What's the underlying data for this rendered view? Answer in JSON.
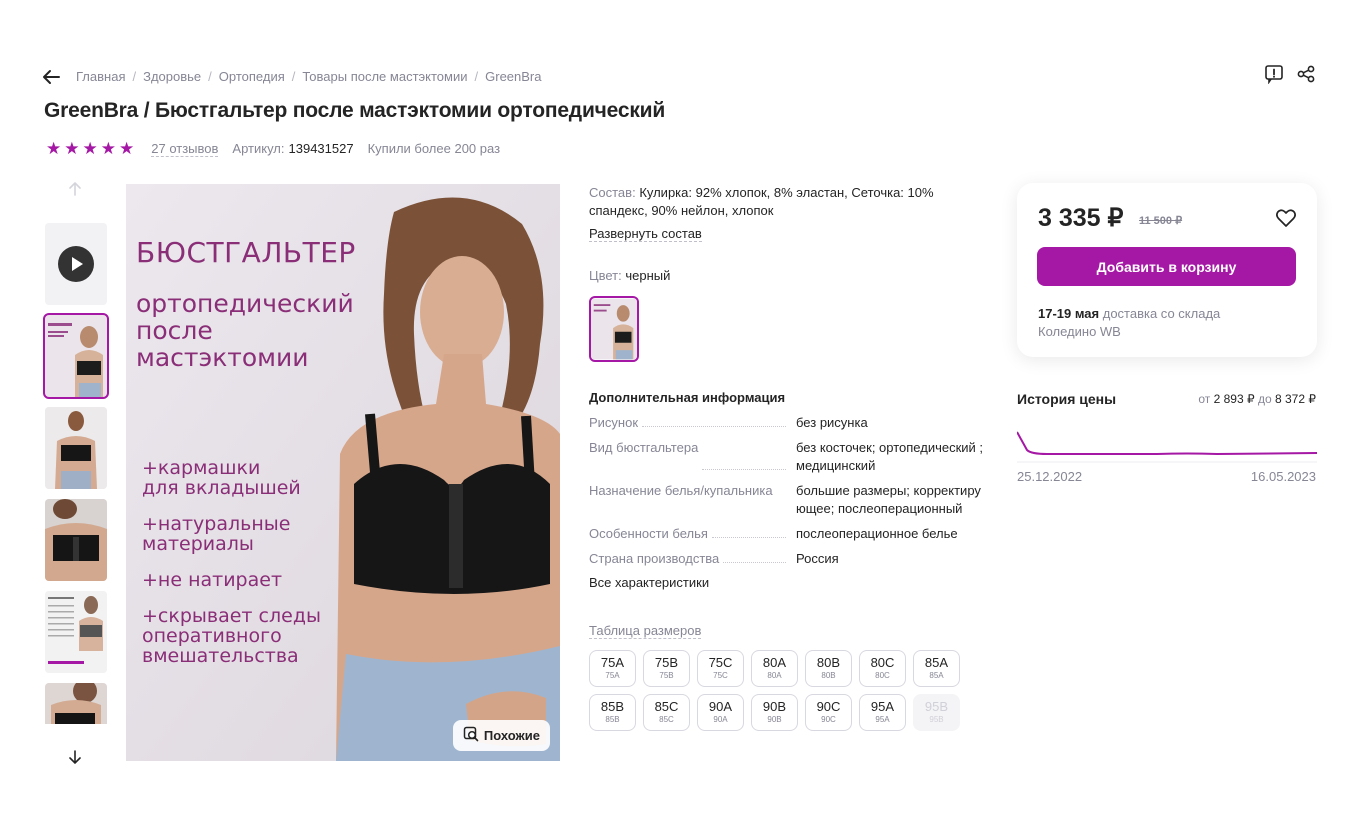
{
  "breadcrumb": [
    "Главная",
    "Здоровье",
    "Ортопедия",
    "Товары после мастэктомии",
    "GreenBra"
  ],
  "breadcrumb_sep": "/",
  "title": "GreenBra / Бюстгальтер после мастэктомии ортопедический",
  "rating": {
    "stars": 5,
    "reviews": "27 отзывов"
  },
  "article": {
    "label": "Артикул:",
    "value": "139431527"
  },
  "bought": "Купили более 200 раз",
  "icons": {
    "back": "arrow-left-icon",
    "report": "report-icon",
    "share": "share-icon",
    "play": "play-icon",
    "heart": "heart-icon",
    "similar": "search-similar-icon"
  },
  "promo": {
    "heading": "БЮСТГАЛЬТЕР",
    "sub": "ортопедический\nпосле\nмастэктомии",
    "bullets": [
      "+кармашки\nдля вкладышей",
      "+натуральные\nматериалы",
      "+не натирает",
      "+скрывает следы\nоперативного\nвмешательства"
    ]
  },
  "similar_label": "Похожие",
  "composition": {
    "label": "Состав:",
    "value": "Кулирка: 92% хлопок, 8% эластан, Сеточка: 10% спандекс, 90% нейлон, хлопок",
    "expand": "Развернуть состав"
  },
  "color": {
    "label": "Цвет:",
    "value": "черный"
  },
  "additional": {
    "title": "Дополнительная информация",
    "props": [
      {
        "k": "Рисунок",
        "v": "без рисунка"
      },
      {
        "k": "Вид бюстгальтера",
        "v": "без косточек; ортопедический ; медицинский"
      },
      {
        "k": "Назначение белья/купальника",
        "v": "большие размеры; корректирующее; послеоперационный"
      },
      {
        "k": "Особенности белья",
        "v": "послеоперационное белье"
      },
      {
        "k": "Страна производства",
        "v": "Россия"
      }
    ],
    "all": "Все характеристики"
  },
  "size_table": "Таблица размеров",
  "sizes": [
    {
      "s": "75A",
      "r": "75A"
    },
    {
      "s": "75B",
      "r": "75B"
    },
    {
      "s": "75C",
      "r": "75C"
    },
    {
      "s": "80A",
      "r": "80A"
    },
    {
      "s": "80B",
      "r": "80B"
    },
    {
      "s": "80C",
      "r": "80C"
    },
    {
      "s": "85A",
      "r": "85A"
    },
    {
      "s": "85B",
      "r": "85B"
    },
    {
      "s": "85C",
      "r": "85C"
    },
    {
      "s": "90A",
      "r": "90A"
    },
    {
      "s": "90B",
      "r": "90B"
    },
    {
      "s": "90C",
      "r": "90C"
    },
    {
      "s": "95A",
      "r": "95A"
    },
    {
      "s": "95B",
      "r": "95B",
      "disabled": true
    }
  ],
  "price": {
    "current": "3 335 ₽",
    "old": "11 500 ₽",
    "button": "Добавить в корзину"
  },
  "delivery": {
    "dates": "17-19 мая",
    "text": " доставка со склада",
    "warehouse": "Коледино WB"
  },
  "history": {
    "title": "История цены",
    "range_from_label": "от",
    "range_from": "2 893 ₽",
    "range_to_label": "до",
    "range_to": "8 372 ₽",
    "start": "25.12.2022",
    "end": "16.05.2023"
  },
  "colors": {
    "accent": "#a517a5",
    "text": "#242424",
    "muted": "#868695"
  }
}
